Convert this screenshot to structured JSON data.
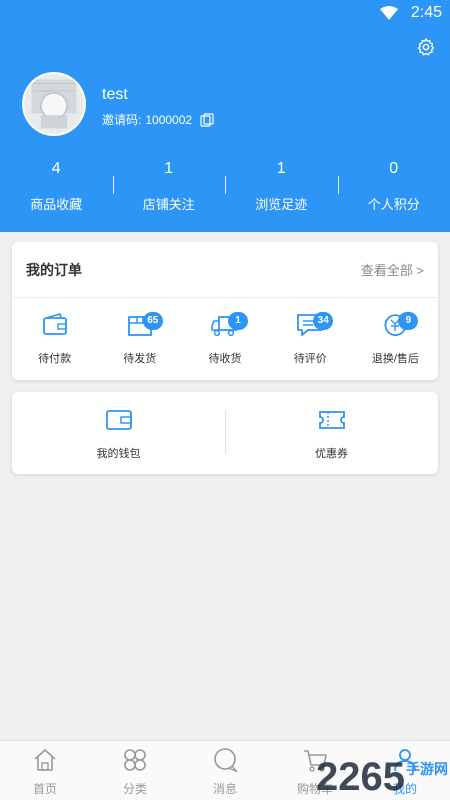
{
  "status_bar": {
    "time": "2:45"
  },
  "profile": {
    "username": "test",
    "invite_label": "邀请码:",
    "invite_code": "1000002"
  },
  "stats": [
    {
      "value": "4",
      "label": "商品收藏"
    },
    {
      "value": "1",
      "label": "店铺关注"
    },
    {
      "value": "1",
      "label": "浏览足迹"
    },
    {
      "value": "0",
      "label": "个人积分"
    }
  ],
  "orders": {
    "title": "我的订单",
    "view_all": "查看全部 >",
    "items": [
      {
        "label": "待付款",
        "icon": "wallet-icon",
        "badge": ""
      },
      {
        "label": "待发货",
        "icon": "package-icon",
        "badge": "65"
      },
      {
        "label": "待收货",
        "icon": "truck-icon",
        "badge": "1"
      },
      {
        "label": "待评价",
        "icon": "comment-icon",
        "badge": "34"
      },
      {
        "label": "退换/售后",
        "icon": "refund-icon",
        "badge": "9"
      }
    ]
  },
  "wallet": {
    "items": [
      {
        "label": "我的钱包",
        "icon": "wallet-icon"
      },
      {
        "label": "优惠券",
        "icon": "coupon-icon"
      }
    ]
  },
  "tabbar": {
    "items": [
      {
        "label": "首页",
        "icon": "home-icon",
        "active": false
      },
      {
        "label": "分类",
        "icon": "category-icon",
        "active": false
      },
      {
        "label": "消息",
        "icon": "message-icon",
        "active": false
      },
      {
        "label": "购物车",
        "icon": "cart-icon",
        "active": false
      },
      {
        "label": "我的",
        "icon": "user-icon",
        "active": true
      }
    ]
  },
  "watermark": {
    "text": "2265",
    "sub": "手游网"
  },
  "colors": {
    "primary": "#2d95f6",
    "background": "#efefef",
    "text": "#333333",
    "muted": "#999999"
  }
}
